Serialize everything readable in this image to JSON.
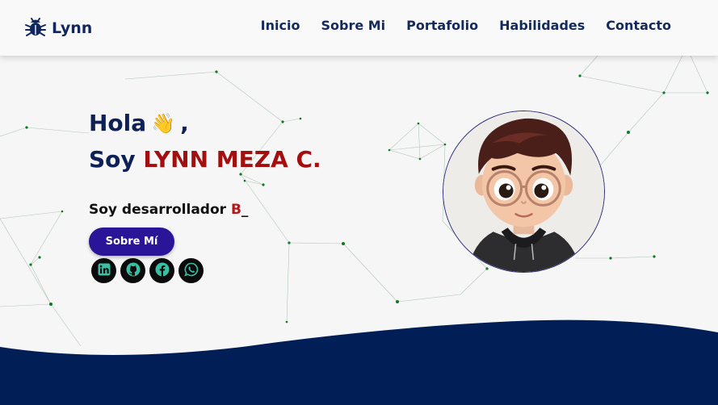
{
  "header": {
    "brand": "Lynn",
    "logo_icon": "bug-icon",
    "nav": [
      {
        "label": "Inicio"
      },
      {
        "label": "Sobre Mi"
      },
      {
        "label": "Portafolio"
      },
      {
        "label": "Habilidades"
      },
      {
        "label": "Contacto"
      }
    ]
  },
  "hero": {
    "greeting": "Hola",
    "greeting_emoji": "👋",
    "greeting_comma": ",",
    "intro_prefix": "Soy",
    "name": "LYNN MEZA C.",
    "role_prefix": "Soy desarrollador",
    "typed_text": "B",
    "cursor": "_",
    "about_button": "Sobre Mí",
    "socials": [
      {
        "icon": "linkedin-icon"
      },
      {
        "icon": "github-icon"
      },
      {
        "icon": "facebook-icon"
      },
      {
        "icon": "whatsapp-icon"
      }
    ]
  },
  "colors": {
    "navy": "#0d2156",
    "accent_red": "#a30e0e",
    "button": "#2a1599",
    "wave": "#021e57",
    "particles": "#1f7a2e"
  }
}
